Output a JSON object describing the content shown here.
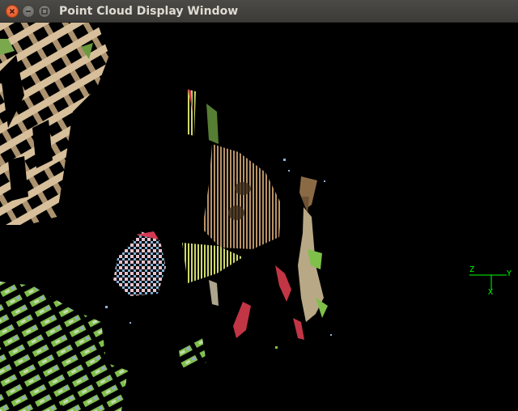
{
  "window": {
    "title": "Point Cloud Display Window"
  },
  "axes_widget": {
    "labels": {
      "z": "Z",
      "y": "Y",
      "x": "X"
    },
    "color": "#00ff00"
  },
  "colors": {
    "background": "#000000",
    "titlebar": "#3c3b37",
    "close_button": "#df4a16"
  }
}
